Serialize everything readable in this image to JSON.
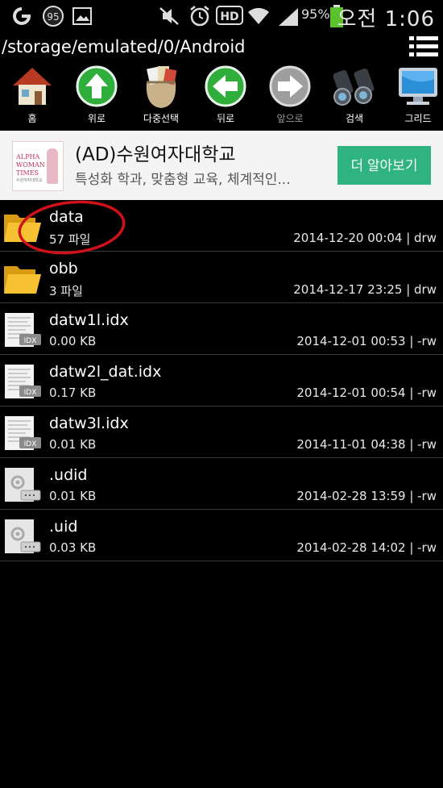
{
  "status_bar": {
    "badge_number": "95",
    "battery_percent": "95%",
    "clock": "오전 1:06"
  },
  "path": "/storage/emulated/0/Android",
  "toolbar": [
    {
      "label": "홈",
      "icon": "house-icon",
      "enabled": true
    },
    {
      "label": "위로",
      "icon": "arrow-up-icon",
      "enabled": true
    },
    {
      "label": "다중선택",
      "icon": "multi-select-bag-icon",
      "enabled": true
    },
    {
      "label": "뒤로",
      "icon": "arrow-left-icon",
      "enabled": true
    },
    {
      "label": "앞으로",
      "icon": "arrow-right-icon",
      "enabled": false
    },
    {
      "label": "검색",
      "icon": "binoculars-icon",
      "enabled": true
    },
    {
      "label": "그리드",
      "icon": "monitor-icon",
      "enabled": true
    }
  ],
  "ad": {
    "logo_line1": "ALPHA",
    "logo_line2": "WOMAN",
    "logo_line3": "TIMES",
    "logo_sub": "수원여자대학교",
    "title": "(AD)수원여자대학교",
    "description": "특성화 학과, 맞춤형 교육, 체계적인...",
    "button": "더 알아보기"
  },
  "files": [
    {
      "name": "data",
      "size": "57 파일",
      "modified": "2014-12-20 00:04",
      "perm": "drw",
      "type": "folder"
    },
    {
      "name": "obb",
      "size": "3 파일",
      "modified": "2014-12-17 23:25",
      "perm": "drw",
      "type": "folder"
    },
    {
      "name": "datw1l.idx",
      "size": "0.00 KB",
      "modified": "2014-12-01 00:53",
      "perm": "-rw",
      "type": "idx"
    },
    {
      "name": "datw2l_dat.idx",
      "size": "0.17 KB",
      "modified": "2014-12-01 00:54",
      "perm": "-rw",
      "type": "idx"
    },
    {
      "name": "datw3l.idx",
      "size": "0.01 KB",
      "modified": "2014-11-01 04:38",
      "perm": "-rw",
      "type": "idx"
    },
    {
      "name": ".udid",
      "size": "0.01 KB",
      "modified": "2014-02-28 13:59",
      "perm": "-rw",
      "type": "generic"
    },
    {
      "name": ".uid",
      "size": "0.03 KB",
      "modified": "2014-02-28 14:02",
      "perm": "-rw",
      "type": "generic"
    }
  ],
  "file_type_badge": "IDX",
  "annotation_color": "#d0101a"
}
